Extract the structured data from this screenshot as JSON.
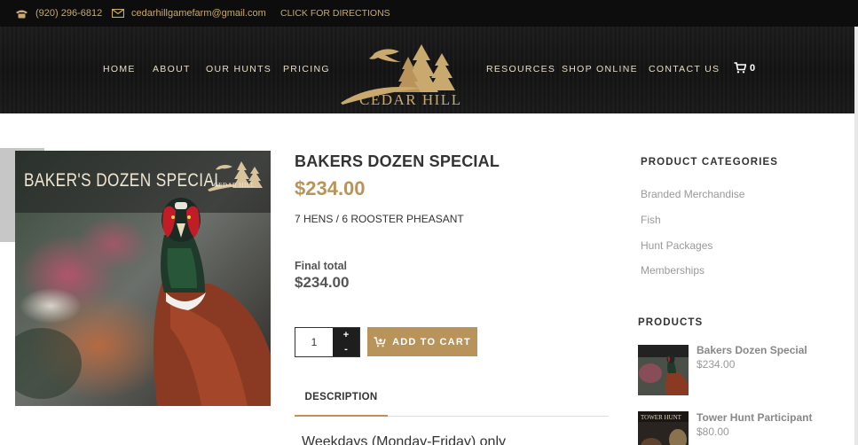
{
  "topbar": {
    "phone": "(920) 296-6812",
    "email": "cedarhillgamefarm@gmail.com",
    "directions": "CLICK FOR DIRECTIONS"
  },
  "nav": {
    "left": [
      "HOME",
      "ABOUT",
      "OUR HUNTS",
      "PRICING"
    ],
    "right": [
      "RESOURCES",
      "SHOP ONLINE",
      "CONTACT US"
    ],
    "cart_count": "0"
  },
  "logo": {
    "text": "CEDAR HILL"
  },
  "product": {
    "image_title": "BAKER'S DOZEN SPECIAL",
    "image_logo_text": "CEDAR HILL",
    "title": "BAKERS DOZEN SPECIAL",
    "price": "$234.00",
    "short_desc": "7 HENS / 6 ROOSTER PHEASANT",
    "final_total_label": "Final total",
    "final_total_value": "$234.00",
    "quantity": "1",
    "qty_plus": "+",
    "qty_minus": "-",
    "add_to_cart": "ADD TO CART",
    "tab_description": "DESCRIPTION",
    "description_first_line": "Weekdays (Monday-Friday) only"
  },
  "sidebar": {
    "categories_heading": "PRODUCT CATEGORIES",
    "categories": [
      "Branded Merchandise",
      "Fish",
      "Hunt Packages",
      "Memberships"
    ],
    "products_heading": "PRODUCTS",
    "products": [
      {
        "name": "Bakers Dozen Special",
        "price": "$234.00"
      },
      {
        "name": "Tower Hunt Participant",
        "price": "$80.00"
      }
    ]
  },
  "colors": {
    "accent": "#b8945a",
    "header_bg": "#141414",
    "topbar_bg": "#0d0d0d"
  },
  "icons": [
    "phone-icon",
    "mail-icon",
    "cart-icon",
    "arrow-left-icon",
    "cart-plus-icon"
  ]
}
